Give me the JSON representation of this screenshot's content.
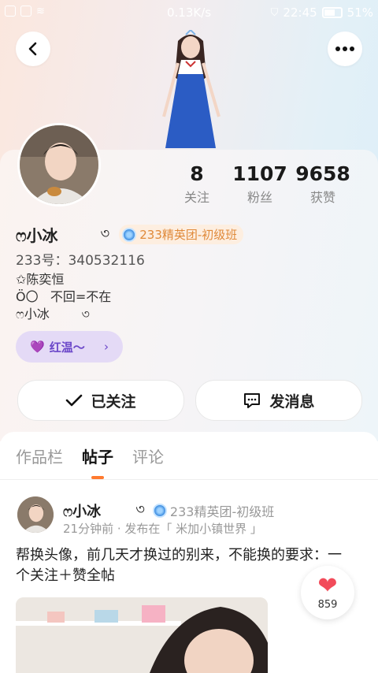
{
  "status_bar": {
    "speed": "0.13K/s",
    "time": "22:45",
    "battery": "51%"
  },
  "stats": [
    {
      "num": "8",
      "label": "关注"
    },
    {
      "num": "1107",
      "label": "粉丝"
    },
    {
      "num": "9658",
      "label": "获赞"
    }
  ],
  "profile": {
    "name": "ෆ小冰",
    "name_symbol": "৩",
    "badge": "233精英团-初级班",
    "uid": "233号：340532116",
    "bio": [
      "✩陈奕恒",
      "Ö〇   不回=不在",
      "ෆ小冰        ৩"
    ],
    "pill_label": "红温～"
  },
  "buttons": {
    "follow": "已关注",
    "message": "发消息"
  },
  "tabs": [
    "作品栏",
    "帖子",
    "评论"
  ],
  "post": {
    "author": "ෆ小冰",
    "author_symbol": "৩",
    "badge": "233精英团-初级班",
    "meta": "21分钟前 · 发布在「 米加小镇世界 」",
    "text": "帮换头像，前几天才换过的别来，不能换的要求：一个关注＋赞全帖",
    "likes": "859"
  },
  "colors": {
    "accent": "#ff7a2f",
    "pill_bg": "#e4daf6",
    "pill_text": "#6b47c9",
    "heart": "#f24b5a"
  }
}
